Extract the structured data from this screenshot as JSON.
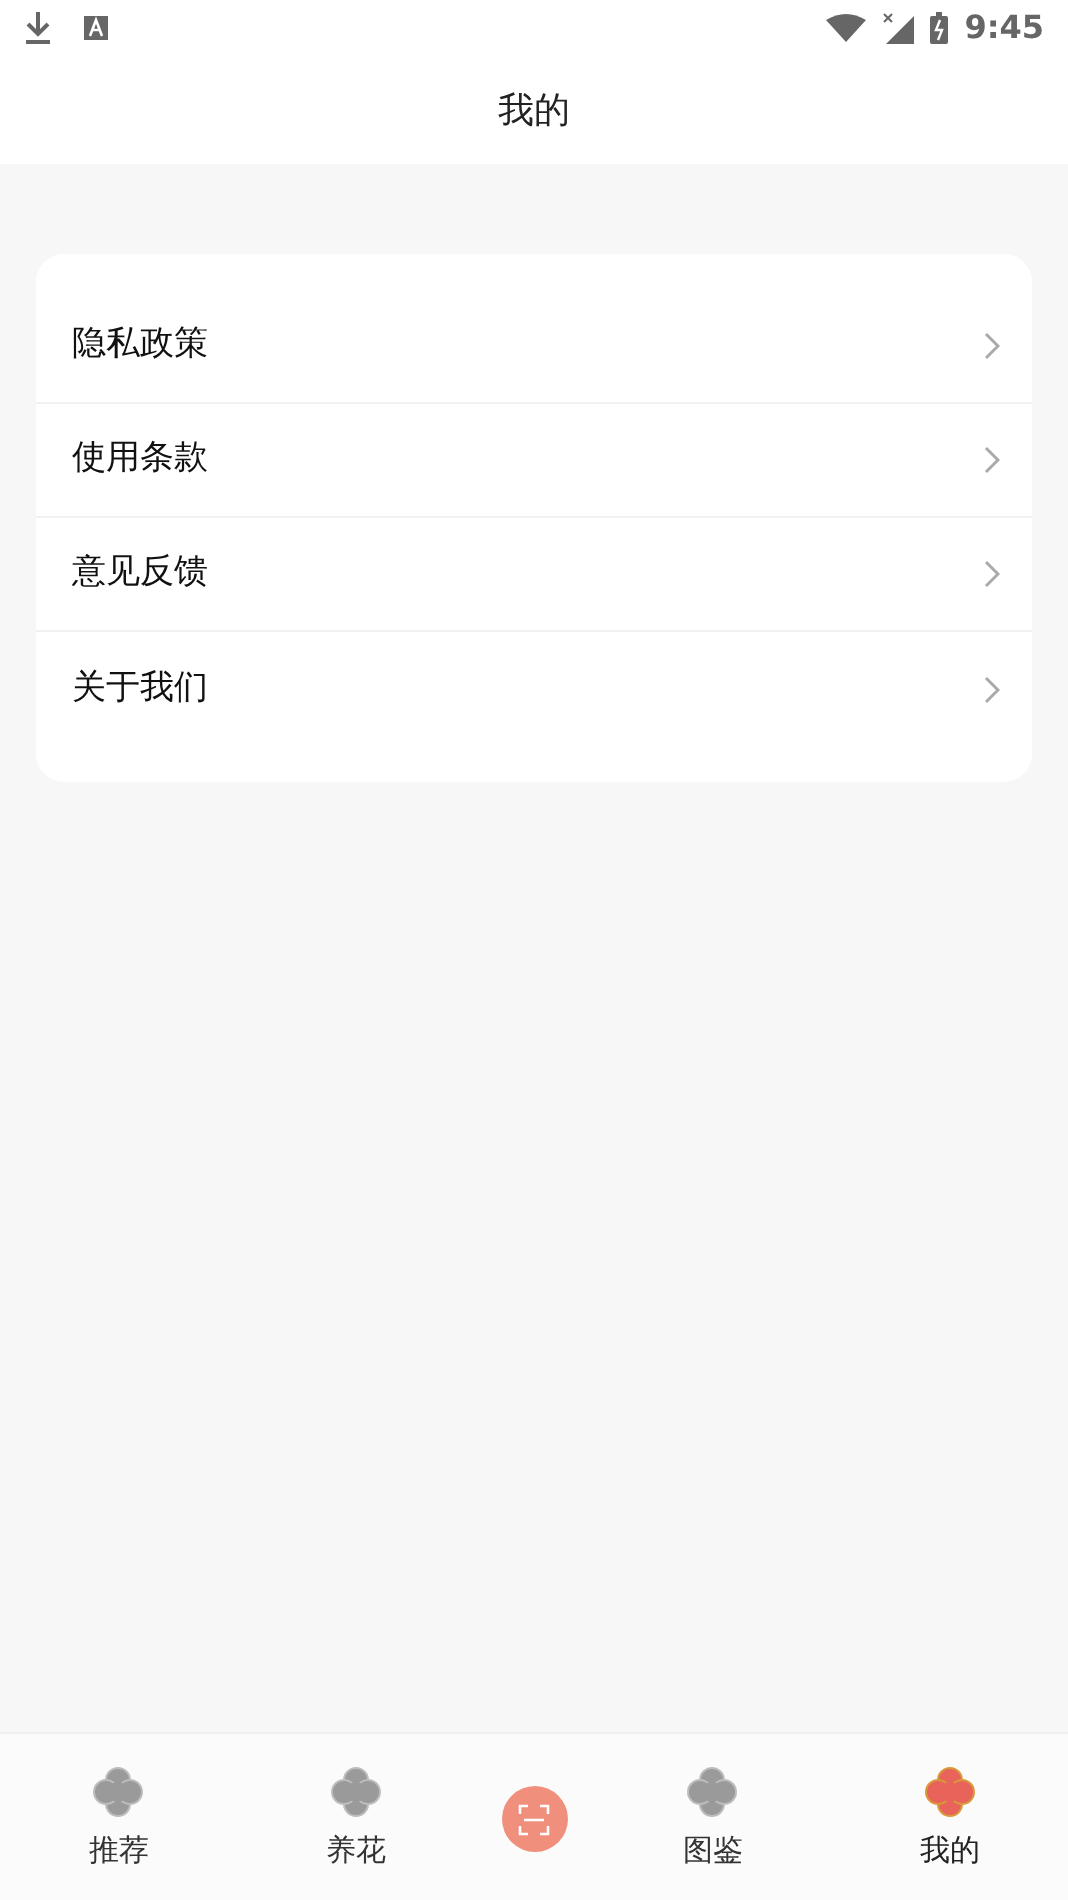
{
  "status_bar": {
    "time": "9:45"
  },
  "header": {
    "title": "我的"
  },
  "menu": [
    {
      "label": "隐私政策"
    },
    {
      "label": "使用条款"
    },
    {
      "label": "意见反馈"
    },
    {
      "label": "关于我们"
    }
  ],
  "tab_bar": [
    {
      "kind": "tab",
      "label": "推荐",
      "selected": false
    },
    {
      "kind": "tab",
      "label": "养花",
      "selected": false
    },
    {
      "kind": "scan"
    },
    {
      "kind": "tab",
      "label": "图鉴",
      "selected": false
    },
    {
      "kind": "tab",
      "label": "我的",
      "selected": true
    }
  ]
}
